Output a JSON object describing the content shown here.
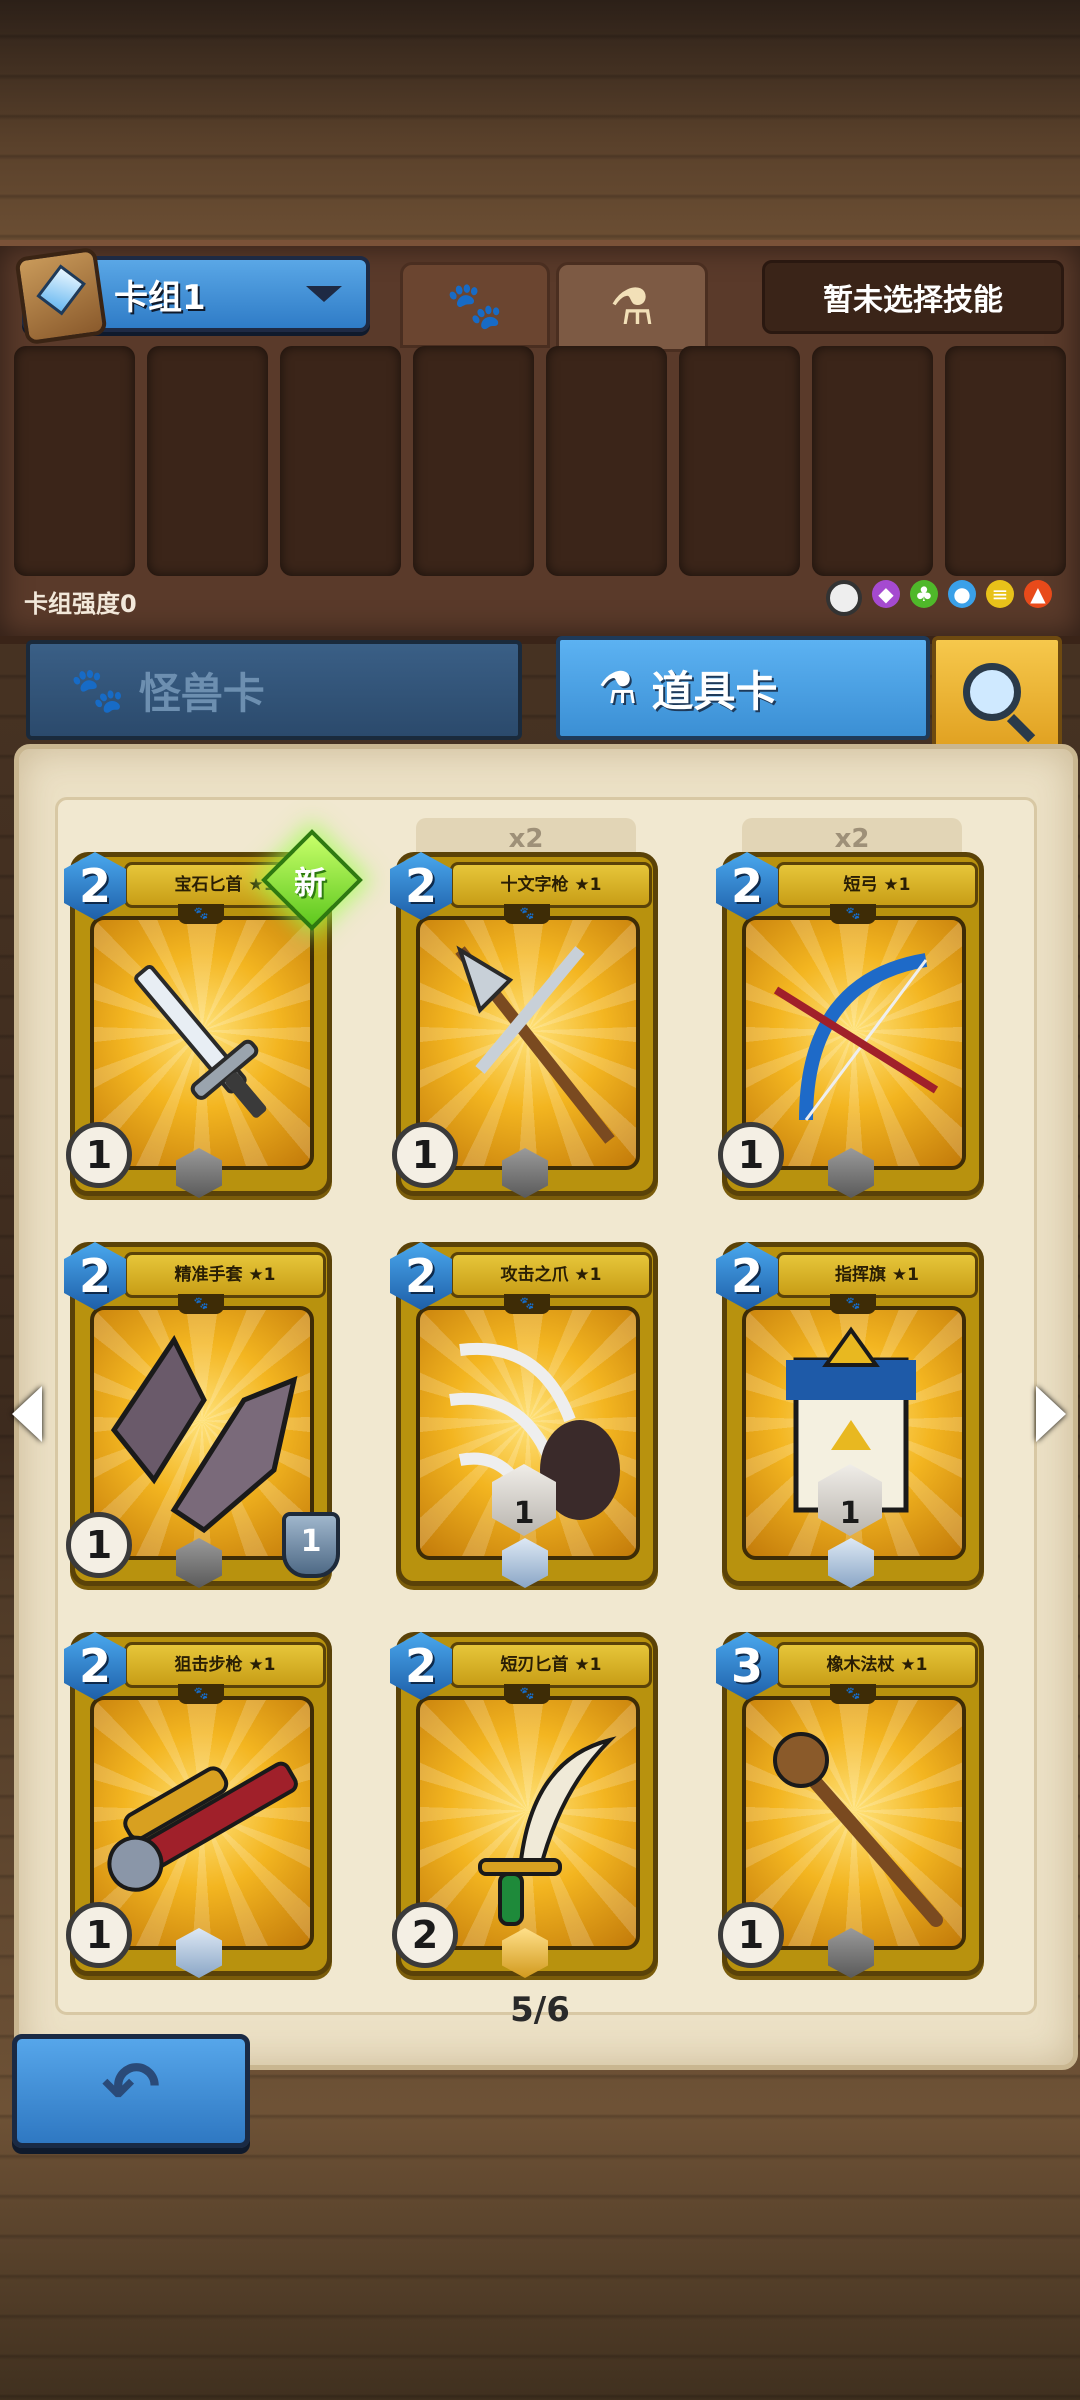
{
  "deck": {
    "name": "卡组1",
    "strength_label": "卡组强度0",
    "skill_text": "暂未选择技能",
    "slots": 8
  },
  "top_tabs": [
    "paw-icon",
    "potion-icon"
  ],
  "card_tabs": {
    "monster": "怪兽卡",
    "item": "道具卡"
  },
  "elements": [
    "neutral-icon",
    "purple-icon",
    "green-icon",
    "blue-icon",
    "yellow-icon",
    "red-icon"
  ],
  "cards": [
    {
      "name": "宝石匕首 ★1",
      "cost": "2",
      "atk": "1",
      "rarity": "gray",
      "badge": "",
      "stack": "",
      "is_new": true,
      "new_label": "新"
    },
    {
      "name": "十文字枪 ★1",
      "cost": "2",
      "atk": "1",
      "rarity": "gray",
      "badge": "",
      "stack": "x2",
      "is_new": false
    },
    {
      "name": "短弓 ★1",
      "cost": "2",
      "atk": "1",
      "rarity": "gray",
      "badge": "",
      "stack": "x2",
      "is_new": false
    },
    {
      "name": "精准手套 ★1",
      "cost": "2",
      "atk": "1",
      "rarity": "gray",
      "badge": "1",
      "stack": "",
      "is_new": false
    },
    {
      "name": "攻击之爪 ★1",
      "cost": "2",
      "atk": "",
      "rarity": "silver",
      "mid": "1",
      "stack": "",
      "is_new": false
    },
    {
      "name": "指挥旗 ★1",
      "cost": "2",
      "atk": "",
      "rarity": "silver",
      "mid": "1",
      "stack": "",
      "is_new": false
    },
    {
      "name": "狙击步枪 ★1",
      "cost": "2",
      "atk": "1",
      "rarity": "silver",
      "badge": "",
      "stack": "",
      "is_new": false
    },
    {
      "name": "短刃匕首 ★1",
      "cost": "2",
      "atk": "2",
      "rarity": "gold",
      "badge": "",
      "stack": "",
      "is_new": false
    },
    {
      "name": "橡木法杖 ★1",
      "cost": "3",
      "atk": "1",
      "rarity": "gray",
      "badge": "",
      "stack": "",
      "is_new": false
    }
  ],
  "page": "5/6",
  "back_icon": "back-arrow-icon",
  "colors": {
    "accent_blue": "#3b8fd4",
    "card_gold": "#e6c63a",
    "panel_brown": "#5a3a2a"
  }
}
